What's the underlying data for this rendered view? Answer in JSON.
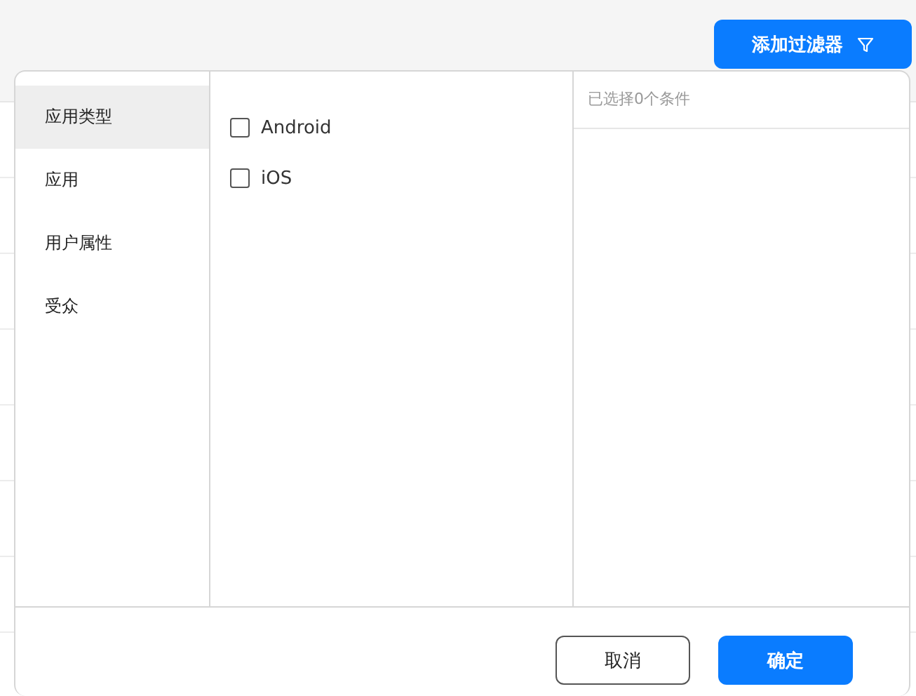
{
  "filter_button": {
    "label": "添加过滤器"
  },
  "categories": [
    {
      "label": "应用类型",
      "selected": true
    },
    {
      "label": "应用",
      "selected": false
    },
    {
      "label": "用户属性",
      "selected": false
    },
    {
      "label": "受众",
      "selected": false
    }
  ],
  "options": [
    {
      "label": "Android",
      "checked": false
    },
    {
      "label": "iOS",
      "checked": false
    }
  ],
  "selected_summary": "已选择0个条件",
  "buttons": [
    {
      "label": "取消",
      "kind": "secondary"
    },
    {
      "label": "确定",
      "kind": "primary"
    }
  ]
}
